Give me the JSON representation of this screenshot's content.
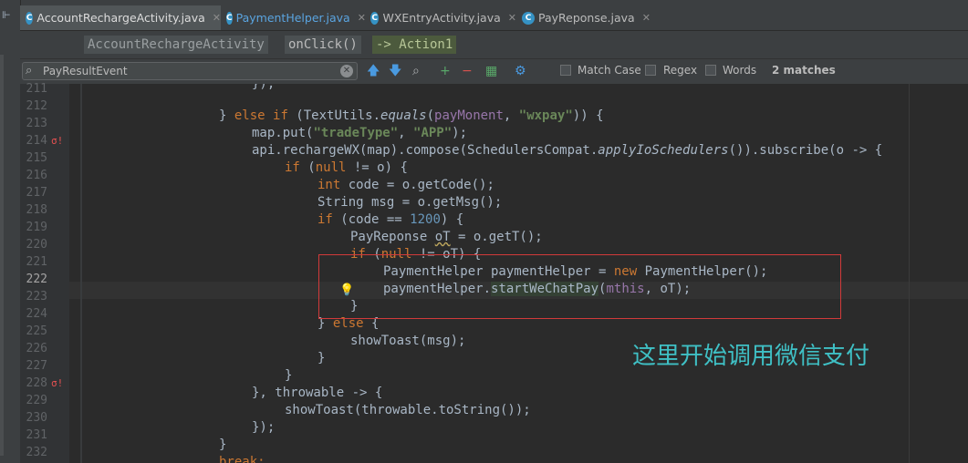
{
  "tabs": [
    {
      "label": "AccountRechargeActivity.java",
      "active": true
    },
    {
      "label": "PaymentHelper.java",
      "active": false
    },
    {
      "label": "WXEntryActivity.java",
      "active": false
    },
    {
      "label": "PayReponse.java",
      "active": false
    }
  ],
  "breadcrumb": {
    "class_name": "AccountRechargeActivity",
    "method": "onClick()",
    "lambda": "-> Action1"
  },
  "search": {
    "value": "PayResultEvent",
    "match_case_label": "Match Case",
    "regex_label": "Regex",
    "words_label": "Words",
    "matches_text": "2 matches",
    "match_case_checked": false,
    "regex_checked": false,
    "words_checked": false
  },
  "gutter": {
    "line_numbers": [
      "211",
      "212",
      "213",
      "214",
      "215",
      "216",
      "217",
      "218",
      "219",
      "220",
      "221",
      "222",
      "223",
      "224",
      "225",
      "226",
      "227",
      "228",
      "229",
      "230",
      "231",
      "232"
    ],
    "current_line": "222",
    "breakpoint_icon": "lambda-breakpoint-icon",
    "intention_icon": "lightbulb-icon"
  },
  "code": {
    "l211": "});",
    "l212_a": "} ",
    "l212_else": "else",
    "l212_sp": " ",
    "l212_if": "if",
    "l212_b": " (TextUtils.",
    "l212_equals": "equals",
    "l212_c": "(",
    "l212_fld": "payMonent",
    "l212_d": ", ",
    "l212_str": "\"wxpay\"",
    "l212_e": ")) {",
    "l213_a": "map.put(",
    "l213_s1": "\"tradeType\"",
    "l213_b": ", ",
    "l213_s2": "\"APP\"",
    "l213_c": ");",
    "l214_a": "api.rechargeWX(map).compose(SchedulersCompat.",
    "l214_m": "applyIoSchedulers",
    "l214_b": "()).subscribe(o -> {",
    "l215_if": "if",
    "l215_a": " (",
    "l215_null": "null",
    "l215_b": " != o) {",
    "l216_int": "int",
    "l216_a": " code = o.getCode();",
    "l217": "String msg = o.getMsg();",
    "l218_if": "if",
    "l218_a": " (code == ",
    "l218_num": "1200",
    "l218_b": ") {",
    "l219_a": "PayReponse ",
    "l219_sq": "oT",
    "l219_b": " = o.getT();",
    "l220_if": "if",
    "l220_a": " (",
    "l220_null": "null",
    "l220_b": " != oT) {",
    "l221_a": "PaymentHelper paymentHelper = ",
    "l221_new": "new",
    "l221_b": " PaymentHelper();",
    "l222_a": "paymentHelper.",
    "l222_call": "startWeChatPay",
    "l222_b": "(",
    "l222_fld": "mthis",
    "l222_c": ", oT);",
    "l223": "}",
    "l224_a": "} ",
    "l224_else": "else",
    "l224_b": " {",
    "l225": "showToast(msg);",
    "l226": "}",
    "l227": "}",
    "l228": "}, throwable -> {",
    "l229": "showToast(throwable.toString());",
    "l230": "});",
    "l231": "}",
    "l232": "break;"
  },
  "annotation": "这里开始调用微信支付",
  "colors": {
    "keyword": "#cc7832",
    "string": "#6a8759",
    "field": "#9876aa",
    "number": "#6897bb",
    "annotation": "#3fc0c5",
    "highlight_box": "#d23a3a"
  }
}
